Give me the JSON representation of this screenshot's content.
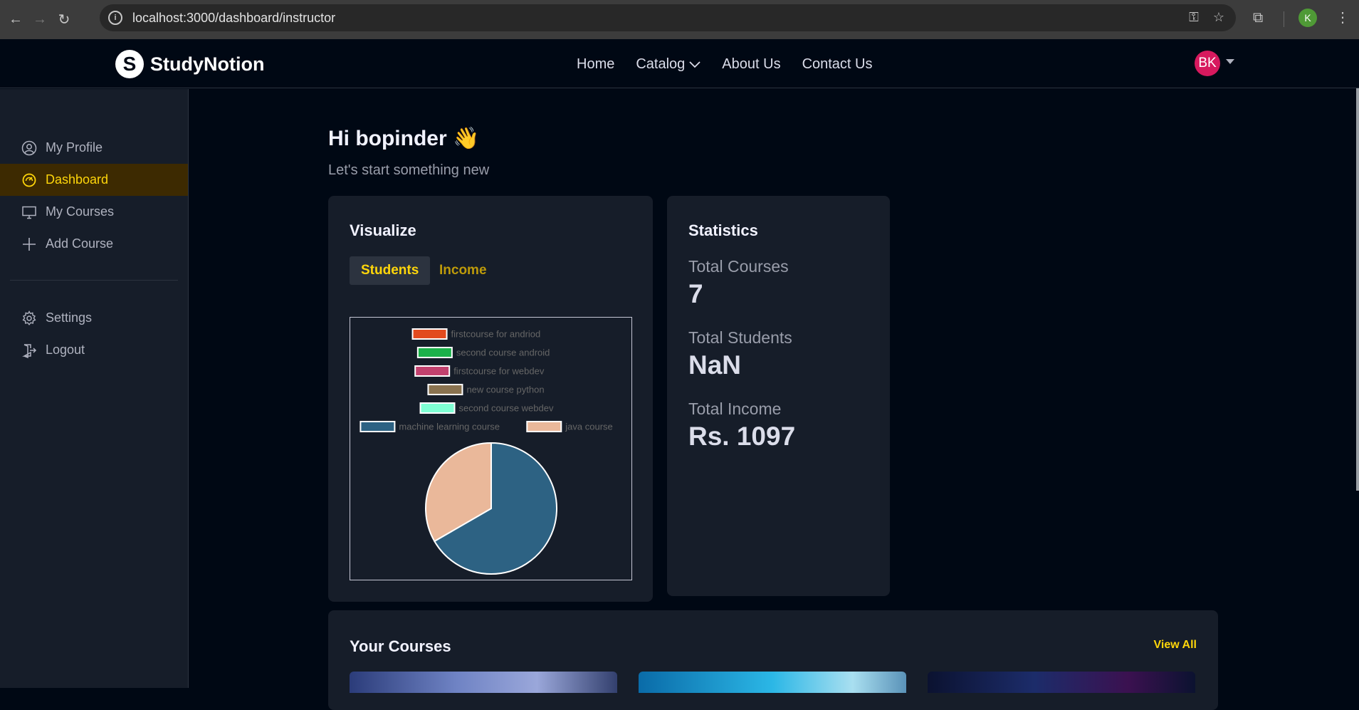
{
  "browser": {
    "url": "localhost:3000/dashboard/instructor",
    "profile_initial": "K"
  },
  "nav": {
    "brand": "StudyNotion",
    "brand_mark": "S",
    "links": [
      "Home",
      "Catalog",
      "About Us",
      "Contact Us"
    ],
    "avatar_initials": "BK"
  },
  "sidebar": {
    "items": [
      {
        "label": "My Profile",
        "icon": "user-circle-icon"
      },
      {
        "label": "Dashboard",
        "icon": "speedometer-icon",
        "active": true
      },
      {
        "label": "My Courses",
        "icon": "monitor-icon"
      },
      {
        "label": "Add Course",
        "icon": "plus-icon"
      }
    ],
    "bottom_items": [
      {
        "label": "Settings",
        "icon": "gear-icon"
      },
      {
        "label": "Logout",
        "icon": "logout-icon"
      }
    ]
  },
  "main": {
    "greeting": "Hi bopinder",
    "greeting_emoji": "👋",
    "subtitle": "Let's start something new"
  },
  "visualize": {
    "title": "Visualize",
    "tabs": [
      "Students",
      "Income"
    ],
    "active_tab": "Students"
  },
  "chart_data": {
    "type": "pie",
    "legend_placement": "top",
    "labels": [
      "firstcourse for andriod",
      "second course android",
      "firstcourse for webdev",
      "new course python",
      "second course webdev",
      "machine learning course",
      "java course"
    ],
    "colors": [
      "#e24a1e",
      "#1bb14a",
      "#c2416e",
      "#8a7350",
      "#7fffd4",
      "#2d6283",
      "#eab89a"
    ],
    "values": [
      0,
      0,
      0,
      0,
      0,
      2,
      1
    ]
  },
  "statistics": {
    "title": "Statistics",
    "items": [
      {
        "label": "Total Courses",
        "value": "7"
      },
      {
        "label": "Total Students",
        "value": "NaN"
      },
      {
        "label": "Total Income",
        "value": "Rs. 1097"
      }
    ]
  },
  "courses": {
    "title": "Your Courses",
    "view_all": "View All"
  }
}
